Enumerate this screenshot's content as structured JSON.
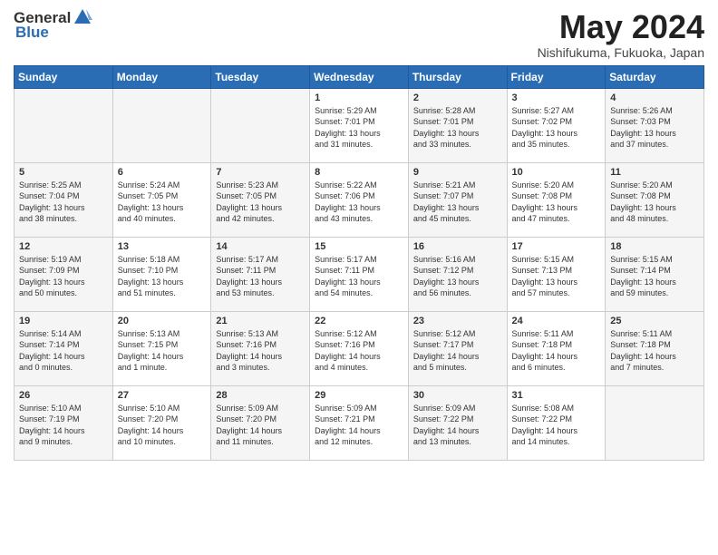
{
  "header": {
    "logo_general": "General",
    "logo_blue": "Blue",
    "title": "May 2024",
    "location": "Nishifukuma, Fukuoka, Japan"
  },
  "days_of_week": [
    "Sunday",
    "Monday",
    "Tuesday",
    "Wednesday",
    "Thursday",
    "Friday",
    "Saturday"
  ],
  "weeks": [
    [
      {
        "day": "",
        "text": ""
      },
      {
        "day": "",
        "text": ""
      },
      {
        "day": "",
        "text": ""
      },
      {
        "day": "1",
        "text": "Sunrise: 5:29 AM\nSunset: 7:01 PM\nDaylight: 13 hours\nand 31 minutes."
      },
      {
        "day": "2",
        "text": "Sunrise: 5:28 AM\nSunset: 7:01 PM\nDaylight: 13 hours\nand 33 minutes."
      },
      {
        "day": "3",
        "text": "Sunrise: 5:27 AM\nSunset: 7:02 PM\nDaylight: 13 hours\nand 35 minutes."
      },
      {
        "day": "4",
        "text": "Sunrise: 5:26 AM\nSunset: 7:03 PM\nDaylight: 13 hours\nand 37 minutes."
      }
    ],
    [
      {
        "day": "5",
        "text": "Sunrise: 5:25 AM\nSunset: 7:04 PM\nDaylight: 13 hours\nand 38 minutes."
      },
      {
        "day": "6",
        "text": "Sunrise: 5:24 AM\nSunset: 7:05 PM\nDaylight: 13 hours\nand 40 minutes."
      },
      {
        "day": "7",
        "text": "Sunrise: 5:23 AM\nSunset: 7:05 PM\nDaylight: 13 hours\nand 42 minutes."
      },
      {
        "day": "8",
        "text": "Sunrise: 5:22 AM\nSunset: 7:06 PM\nDaylight: 13 hours\nand 43 minutes."
      },
      {
        "day": "9",
        "text": "Sunrise: 5:21 AM\nSunset: 7:07 PM\nDaylight: 13 hours\nand 45 minutes."
      },
      {
        "day": "10",
        "text": "Sunrise: 5:20 AM\nSunset: 7:08 PM\nDaylight: 13 hours\nand 47 minutes."
      },
      {
        "day": "11",
        "text": "Sunrise: 5:20 AM\nSunset: 7:08 PM\nDaylight: 13 hours\nand 48 minutes."
      }
    ],
    [
      {
        "day": "12",
        "text": "Sunrise: 5:19 AM\nSunset: 7:09 PM\nDaylight: 13 hours\nand 50 minutes."
      },
      {
        "day": "13",
        "text": "Sunrise: 5:18 AM\nSunset: 7:10 PM\nDaylight: 13 hours\nand 51 minutes."
      },
      {
        "day": "14",
        "text": "Sunrise: 5:17 AM\nSunset: 7:11 PM\nDaylight: 13 hours\nand 53 minutes."
      },
      {
        "day": "15",
        "text": "Sunrise: 5:17 AM\nSunset: 7:11 PM\nDaylight: 13 hours\nand 54 minutes."
      },
      {
        "day": "16",
        "text": "Sunrise: 5:16 AM\nSunset: 7:12 PM\nDaylight: 13 hours\nand 56 minutes."
      },
      {
        "day": "17",
        "text": "Sunrise: 5:15 AM\nSunset: 7:13 PM\nDaylight: 13 hours\nand 57 minutes."
      },
      {
        "day": "18",
        "text": "Sunrise: 5:15 AM\nSunset: 7:14 PM\nDaylight: 13 hours\nand 59 minutes."
      }
    ],
    [
      {
        "day": "19",
        "text": "Sunrise: 5:14 AM\nSunset: 7:14 PM\nDaylight: 14 hours\nand 0 minutes."
      },
      {
        "day": "20",
        "text": "Sunrise: 5:13 AM\nSunset: 7:15 PM\nDaylight: 14 hours\nand 1 minute."
      },
      {
        "day": "21",
        "text": "Sunrise: 5:13 AM\nSunset: 7:16 PM\nDaylight: 14 hours\nand 3 minutes."
      },
      {
        "day": "22",
        "text": "Sunrise: 5:12 AM\nSunset: 7:16 PM\nDaylight: 14 hours\nand 4 minutes."
      },
      {
        "day": "23",
        "text": "Sunrise: 5:12 AM\nSunset: 7:17 PM\nDaylight: 14 hours\nand 5 minutes."
      },
      {
        "day": "24",
        "text": "Sunrise: 5:11 AM\nSunset: 7:18 PM\nDaylight: 14 hours\nand 6 minutes."
      },
      {
        "day": "25",
        "text": "Sunrise: 5:11 AM\nSunset: 7:18 PM\nDaylight: 14 hours\nand 7 minutes."
      }
    ],
    [
      {
        "day": "26",
        "text": "Sunrise: 5:10 AM\nSunset: 7:19 PM\nDaylight: 14 hours\nand 9 minutes."
      },
      {
        "day": "27",
        "text": "Sunrise: 5:10 AM\nSunset: 7:20 PM\nDaylight: 14 hours\nand 10 minutes."
      },
      {
        "day": "28",
        "text": "Sunrise: 5:09 AM\nSunset: 7:20 PM\nDaylight: 14 hours\nand 11 minutes."
      },
      {
        "day": "29",
        "text": "Sunrise: 5:09 AM\nSunset: 7:21 PM\nDaylight: 14 hours\nand 12 minutes."
      },
      {
        "day": "30",
        "text": "Sunrise: 5:09 AM\nSunset: 7:22 PM\nDaylight: 14 hours\nand 13 minutes."
      },
      {
        "day": "31",
        "text": "Sunrise: 5:08 AM\nSunset: 7:22 PM\nDaylight: 14 hours\nand 14 minutes."
      },
      {
        "day": "",
        "text": ""
      }
    ]
  ]
}
